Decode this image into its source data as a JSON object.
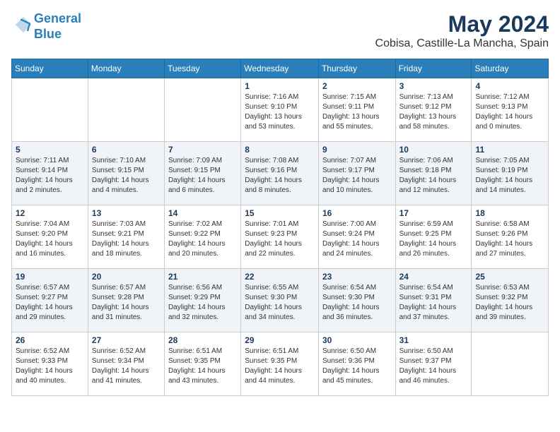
{
  "header": {
    "logo_line1": "General",
    "logo_line2": "Blue",
    "month": "May 2024",
    "location": "Cobisa, Castille-La Mancha, Spain"
  },
  "days_of_week": [
    "Sunday",
    "Monday",
    "Tuesday",
    "Wednesday",
    "Thursday",
    "Friday",
    "Saturday"
  ],
  "weeks": [
    [
      {
        "day": "",
        "info": ""
      },
      {
        "day": "",
        "info": ""
      },
      {
        "day": "",
        "info": ""
      },
      {
        "day": "1",
        "info": "Sunrise: 7:16 AM\nSunset: 9:10 PM\nDaylight: 13 hours and 53 minutes."
      },
      {
        "day": "2",
        "info": "Sunrise: 7:15 AM\nSunset: 9:11 PM\nDaylight: 13 hours and 55 minutes."
      },
      {
        "day": "3",
        "info": "Sunrise: 7:13 AM\nSunset: 9:12 PM\nDaylight: 13 hours and 58 minutes."
      },
      {
        "day": "4",
        "info": "Sunrise: 7:12 AM\nSunset: 9:13 PM\nDaylight: 14 hours and 0 minutes."
      }
    ],
    [
      {
        "day": "5",
        "info": "Sunrise: 7:11 AM\nSunset: 9:14 PM\nDaylight: 14 hours and 2 minutes."
      },
      {
        "day": "6",
        "info": "Sunrise: 7:10 AM\nSunset: 9:15 PM\nDaylight: 14 hours and 4 minutes."
      },
      {
        "day": "7",
        "info": "Sunrise: 7:09 AM\nSunset: 9:15 PM\nDaylight: 14 hours and 6 minutes."
      },
      {
        "day": "8",
        "info": "Sunrise: 7:08 AM\nSunset: 9:16 PM\nDaylight: 14 hours and 8 minutes."
      },
      {
        "day": "9",
        "info": "Sunrise: 7:07 AM\nSunset: 9:17 PM\nDaylight: 14 hours and 10 minutes."
      },
      {
        "day": "10",
        "info": "Sunrise: 7:06 AM\nSunset: 9:18 PM\nDaylight: 14 hours and 12 minutes."
      },
      {
        "day": "11",
        "info": "Sunrise: 7:05 AM\nSunset: 9:19 PM\nDaylight: 14 hours and 14 minutes."
      }
    ],
    [
      {
        "day": "12",
        "info": "Sunrise: 7:04 AM\nSunset: 9:20 PM\nDaylight: 14 hours and 16 minutes."
      },
      {
        "day": "13",
        "info": "Sunrise: 7:03 AM\nSunset: 9:21 PM\nDaylight: 14 hours and 18 minutes."
      },
      {
        "day": "14",
        "info": "Sunrise: 7:02 AM\nSunset: 9:22 PM\nDaylight: 14 hours and 20 minutes."
      },
      {
        "day": "15",
        "info": "Sunrise: 7:01 AM\nSunset: 9:23 PM\nDaylight: 14 hours and 22 minutes."
      },
      {
        "day": "16",
        "info": "Sunrise: 7:00 AM\nSunset: 9:24 PM\nDaylight: 14 hours and 24 minutes."
      },
      {
        "day": "17",
        "info": "Sunrise: 6:59 AM\nSunset: 9:25 PM\nDaylight: 14 hours and 26 minutes."
      },
      {
        "day": "18",
        "info": "Sunrise: 6:58 AM\nSunset: 9:26 PM\nDaylight: 14 hours and 27 minutes."
      }
    ],
    [
      {
        "day": "19",
        "info": "Sunrise: 6:57 AM\nSunset: 9:27 PM\nDaylight: 14 hours and 29 minutes."
      },
      {
        "day": "20",
        "info": "Sunrise: 6:57 AM\nSunset: 9:28 PM\nDaylight: 14 hours and 31 minutes."
      },
      {
        "day": "21",
        "info": "Sunrise: 6:56 AM\nSunset: 9:29 PM\nDaylight: 14 hours and 32 minutes."
      },
      {
        "day": "22",
        "info": "Sunrise: 6:55 AM\nSunset: 9:30 PM\nDaylight: 14 hours and 34 minutes."
      },
      {
        "day": "23",
        "info": "Sunrise: 6:54 AM\nSunset: 9:30 PM\nDaylight: 14 hours and 36 minutes."
      },
      {
        "day": "24",
        "info": "Sunrise: 6:54 AM\nSunset: 9:31 PM\nDaylight: 14 hours and 37 minutes."
      },
      {
        "day": "25",
        "info": "Sunrise: 6:53 AM\nSunset: 9:32 PM\nDaylight: 14 hours and 39 minutes."
      }
    ],
    [
      {
        "day": "26",
        "info": "Sunrise: 6:52 AM\nSunset: 9:33 PM\nDaylight: 14 hours and 40 minutes."
      },
      {
        "day": "27",
        "info": "Sunrise: 6:52 AM\nSunset: 9:34 PM\nDaylight: 14 hours and 41 minutes."
      },
      {
        "day": "28",
        "info": "Sunrise: 6:51 AM\nSunset: 9:35 PM\nDaylight: 14 hours and 43 minutes."
      },
      {
        "day": "29",
        "info": "Sunrise: 6:51 AM\nSunset: 9:35 PM\nDaylight: 14 hours and 44 minutes."
      },
      {
        "day": "30",
        "info": "Sunrise: 6:50 AM\nSunset: 9:36 PM\nDaylight: 14 hours and 45 minutes."
      },
      {
        "day": "31",
        "info": "Sunrise: 6:50 AM\nSunset: 9:37 PM\nDaylight: 14 hours and 46 minutes."
      },
      {
        "day": "",
        "info": ""
      }
    ]
  ]
}
